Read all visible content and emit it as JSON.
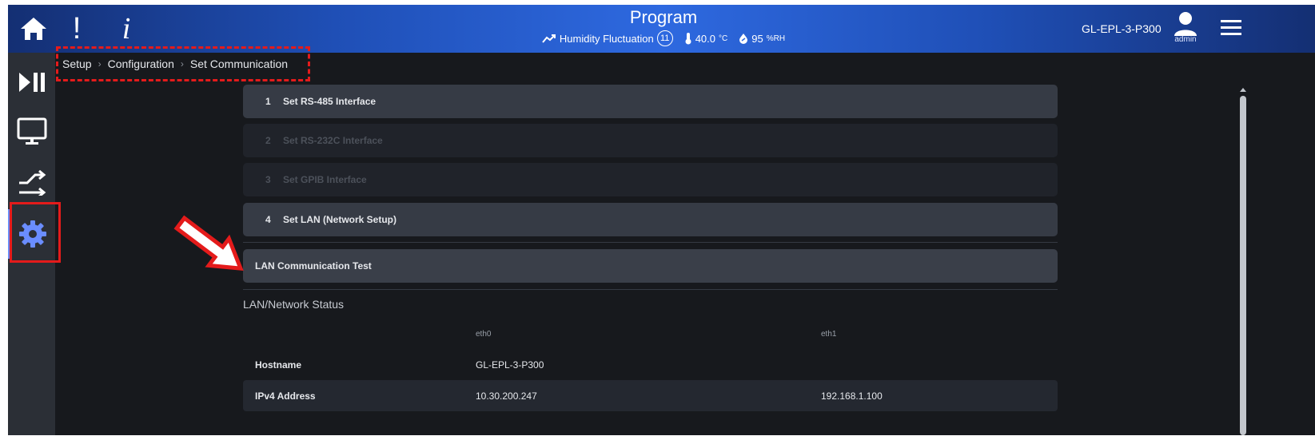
{
  "header": {
    "title": "Program",
    "status": {
      "program_name": "Humidity Fluctuation",
      "step": "11",
      "temperature": "40.0",
      "temperature_unit": "°C",
      "humidity": "95",
      "humidity_unit": "%RH"
    },
    "device_id": "GL-EPL-3-P300",
    "user": "admin"
  },
  "sidebar": {
    "items": [
      {
        "name": "home",
        "icon": "home-icon"
      },
      {
        "name": "play-pause",
        "icon": "play-pause-icon"
      },
      {
        "name": "monitor",
        "icon": "monitor-icon"
      },
      {
        "name": "transfer",
        "icon": "transfer-icon"
      },
      {
        "name": "setup",
        "icon": "gear-icon",
        "active": true
      }
    ]
  },
  "breadcrumb": [
    "Setup",
    "Configuration",
    "Set Communication"
  ],
  "menu": [
    {
      "num": "1",
      "label": "Set RS-485 Interface",
      "enabled": true
    },
    {
      "num": "2",
      "label": "Set RS-232C Interface",
      "enabled": false
    },
    {
      "num": "3",
      "label": "Set GPIB Interface",
      "enabled": false
    },
    {
      "num": "4",
      "label": "Set LAN (Network Setup)",
      "enabled": true
    }
  ],
  "lan_test_label": "LAN Communication Test",
  "network_status": {
    "title": "LAN/Network Status",
    "columns": [
      "eth0",
      "eth1"
    ],
    "rows": [
      {
        "label": "Hostname",
        "eth0": "GL-EPL-3-P300",
        "eth1": ""
      },
      {
        "label": "IPv4 Address",
        "eth0": "10.30.200.247",
        "eth1": "192.168.1.100"
      }
    ]
  },
  "colors": {
    "header_accent": "#2e69e0",
    "active_nav": "#6a8dff",
    "annotation": "#e41b1b"
  }
}
